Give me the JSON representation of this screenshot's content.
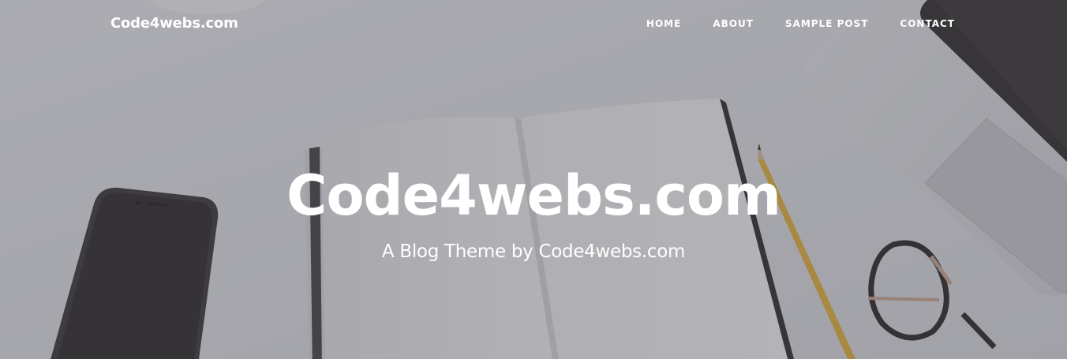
{
  "nav": {
    "brand": "Code4webs.com",
    "links": [
      {
        "label": "HOME"
      },
      {
        "label": "ABOUT"
      },
      {
        "label": "SAMPLE POST"
      },
      {
        "label": "CONTACT"
      }
    ]
  },
  "hero": {
    "title": "Code4webs.com",
    "subtitle": "A Blog Theme by Code4webs.com"
  },
  "colors": {
    "text": "#ffffff",
    "background": "#c8c9cd"
  }
}
